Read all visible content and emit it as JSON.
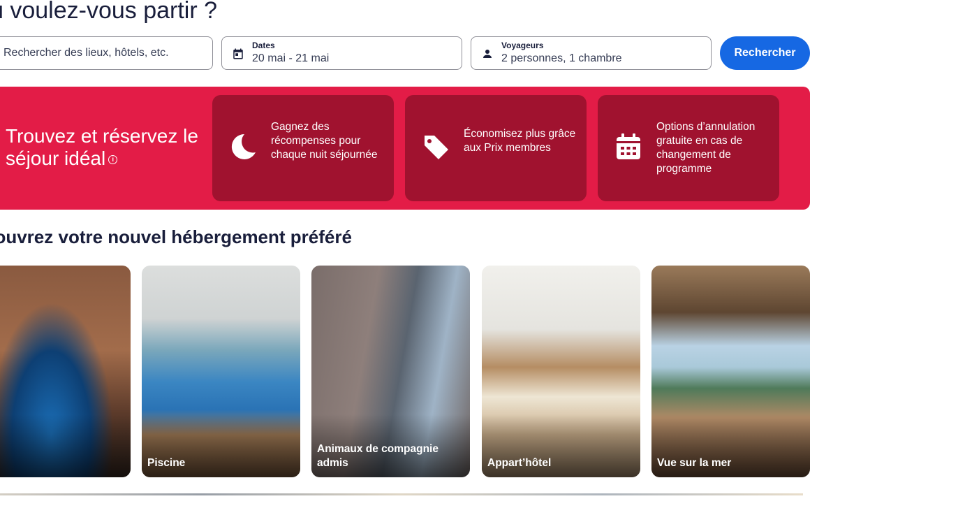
{
  "page": {
    "heading": "ù voulez-vous partir ?",
    "sub_heading": "couvrez votre nouvel hébergement préféré"
  },
  "search": {
    "placeholder": "Rechercher des lieux, hôtels, etc.",
    "dates_label": "Dates",
    "dates_value": "20 mai - 21 mai",
    "travelers_label": "Voyageurs",
    "travelers_value": "2 personnes, 1 chambre",
    "button_label": "Rechercher"
  },
  "promo": {
    "title": "Trouvez et réservez le séjour idéal",
    "info_icon": "i",
    "cards": [
      {
        "icon": "moon-icon",
        "text": "Gagnez des récompenses pour chaque nuit séjournée"
      },
      {
        "icon": "tag-icon",
        "text": "Économisez plus grâce aux Prix membres"
      },
      {
        "icon": "calendar-icon",
        "text": "Options d’annulation gratuite en cas de changement de programme"
      }
    ]
  },
  "categories": [
    {
      "label": ""
    },
    {
      "label": "Piscine"
    },
    {
      "label": "Animaux de compagnie admis"
    },
    {
      "label": "Appart’hôtel"
    },
    {
      "label": "Vue sur la mer"
    }
  ],
  "colors": {
    "primary_button": "#1668e3",
    "promo_background": "#e31c47",
    "promo_card": "#a0122f",
    "text": "#191e3b"
  }
}
